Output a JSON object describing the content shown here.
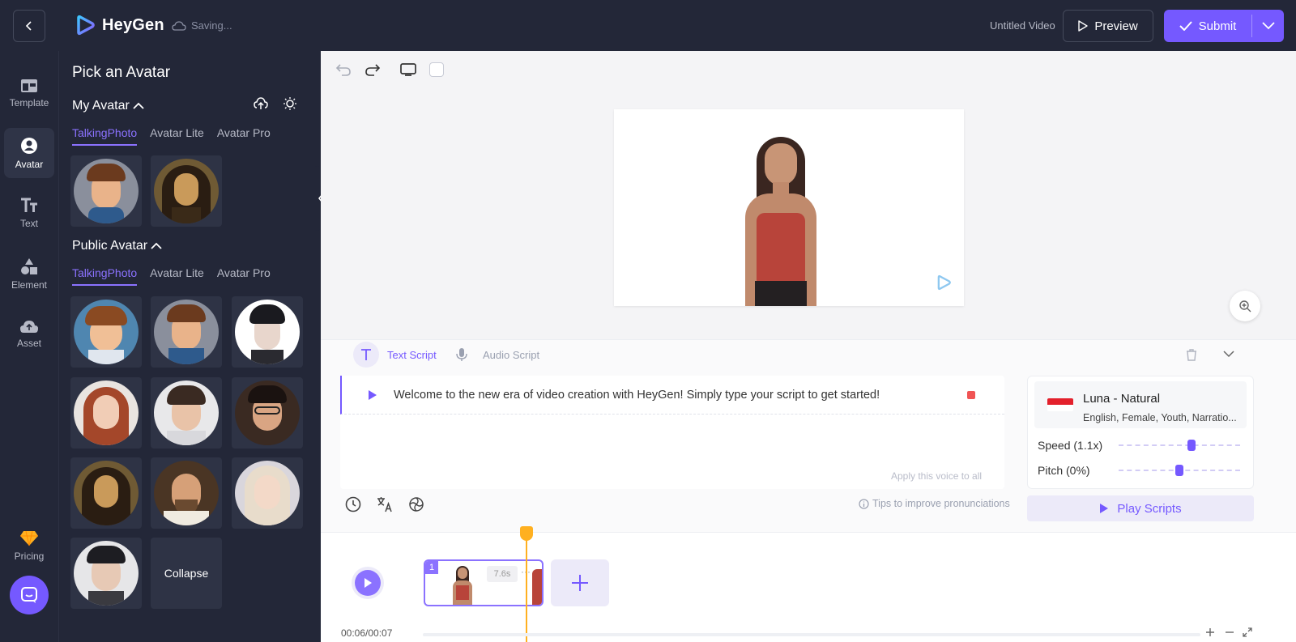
{
  "header": {
    "brand": "HeyGen",
    "saving_status": "Saving...",
    "video_title": "Untitled Video",
    "preview_label": "Preview",
    "submit_label": "Submit",
    "accent_color": "#7559ff"
  },
  "nav": {
    "items": [
      {
        "label": "Template",
        "icon": "template-icon"
      },
      {
        "label": "Avatar",
        "icon": "avatar-icon"
      },
      {
        "label": "Text",
        "icon": "text-icon"
      },
      {
        "label": "Element",
        "icon": "element-icon"
      },
      {
        "label": "Asset",
        "icon": "cloud-icon"
      }
    ],
    "pricing_label": "Pricing"
  },
  "panel": {
    "title": "Pick an Avatar",
    "my_avatar": {
      "title": "My Avatar",
      "tabs": [
        "TalkingPhoto",
        "Avatar Lite",
        "Avatar Pro"
      ]
    },
    "public_avatar": {
      "title": "Public Avatar",
      "tabs": [
        "TalkingPhoto",
        "Avatar Lite",
        "Avatar Pro"
      ]
    },
    "collapse_label": "Collapse"
  },
  "script": {
    "text_script_label": "Text Script",
    "audio_script_label": "Audio Script",
    "text": "Welcome to the new era of video creation with HeyGen! Simply type your script to get started!",
    "apply_voice_label": "Apply this voice to all",
    "tips_label": "Tips to improve pronunciations"
  },
  "voice": {
    "name": "Luna - Natural",
    "description": "English, Female, Youth, Narratio...",
    "speed_label": "Speed (1.1x)",
    "pitch_label": "Pitch (0%)",
    "speed_value": 0.6,
    "pitch_value": 0.5,
    "play_label": "Play Scripts"
  },
  "timeline": {
    "clip_number": "1",
    "clip_duration": "7.6s",
    "clip_more": "···",
    "time": "00:06/00:07"
  }
}
